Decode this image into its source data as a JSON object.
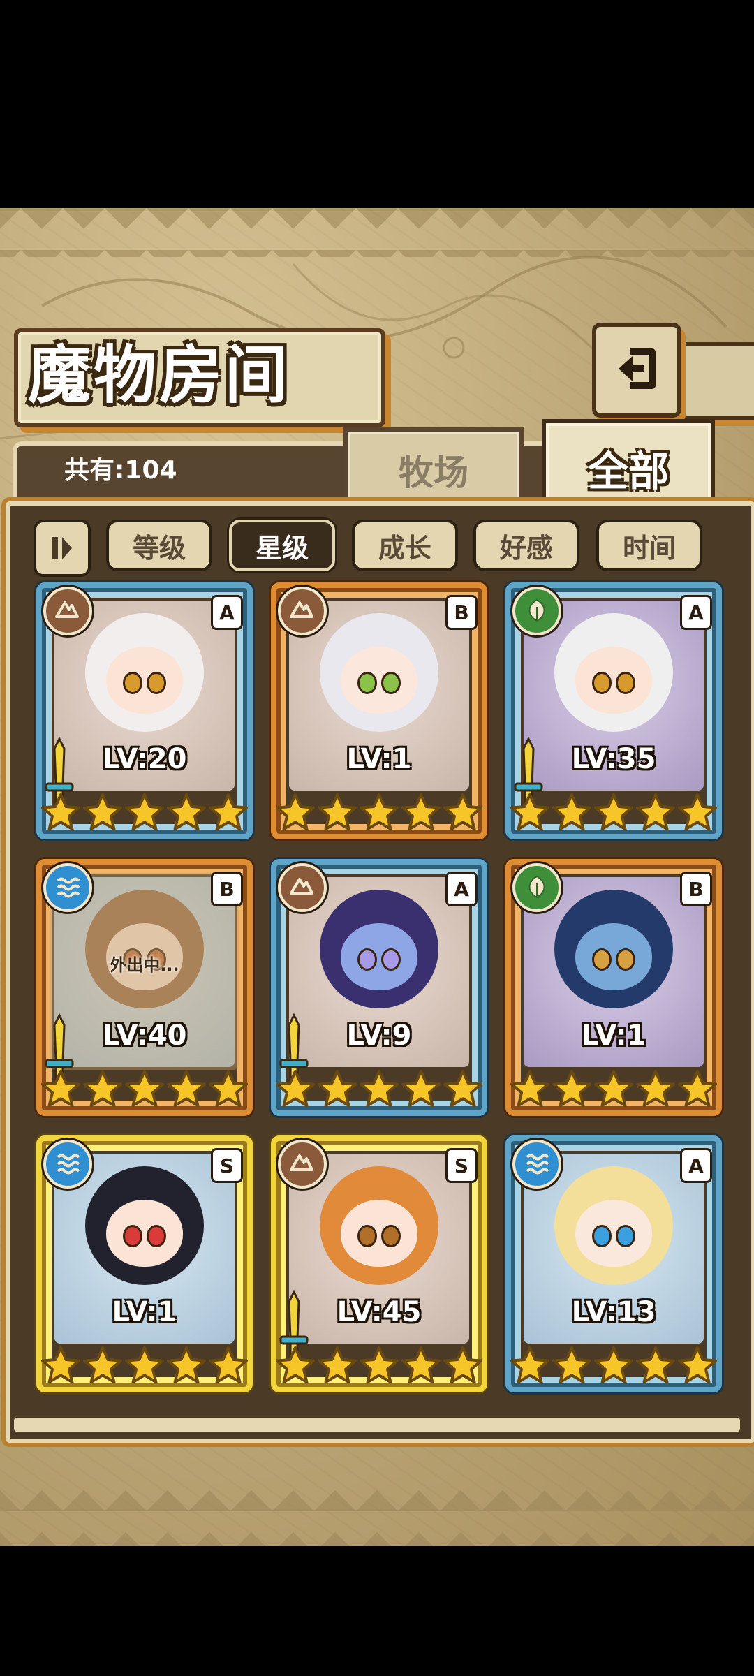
{
  "header": {
    "title": "魔物房间",
    "back_icon": "back-arrow-icon"
  },
  "summary": {
    "count_label": "共有:104"
  },
  "tabs": [
    {
      "label": "牧场",
      "active": false
    },
    {
      "label": "全部",
      "active": true
    }
  ],
  "filters": {
    "toggle_icon": "sort-toggle-icon",
    "buttons": [
      {
        "label": "等级",
        "active": false
      },
      {
        "label": "星级",
        "active": true
      },
      {
        "label": "成长",
        "active": false
      },
      {
        "label": "好感",
        "active": false
      },
      {
        "label": "时间",
        "active": false
      }
    ]
  },
  "monsters": [
    {
      "level": "LV:20",
      "rank": "A",
      "element": "earth",
      "frame": "blue",
      "stars": 5,
      "weapon": true,
      "away": ""
    },
    {
      "level": "LV:1",
      "rank": "B",
      "element": "earth",
      "frame": "bronze",
      "stars": 5,
      "weapon": false,
      "away": ""
    },
    {
      "level": "LV:35",
      "rank": "A",
      "element": "nature",
      "frame": "blue",
      "stars": 5,
      "weapon": true,
      "away": ""
    },
    {
      "level": "LV:40",
      "rank": "B",
      "element": "water",
      "frame": "bronze",
      "stars": 5,
      "weapon": true,
      "away": "外出中..."
    },
    {
      "level": "LV:9",
      "rank": "A",
      "element": "earth",
      "frame": "blue",
      "stars": 5,
      "weapon": true,
      "away": ""
    },
    {
      "level": "LV:1",
      "rank": "B",
      "element": "nature",
      "frame": "bronze",
      "stars": 5,
      "weapon": false,
      "away": ""
    },
    {
      "level": "LV:1",
      "rank": "S",
      "element": "water",
      "frame": "gold",
      "stars": 5,
      "weapon": false,
      "away": ""
    },
    {
      "level": "LV:45",
      "rank": "S",
      "element": "earth",
      "frame": "gold",
      "stars": 5,
      "weapon": true,
      "away": ""
    },
    {
      "level": "LV:13",
      "rank": "A",
      "element": "water",
      "frame": "blue",
      "stars": 5,
      "weapon": false,
      "away": ""
    }
  ],
  "colors": {
    "parchment": "#bca677",
    "panel": "#4b3a26",
    "accent_orange": "#c9862f",
    "star": "#f6c628"
  }
}
